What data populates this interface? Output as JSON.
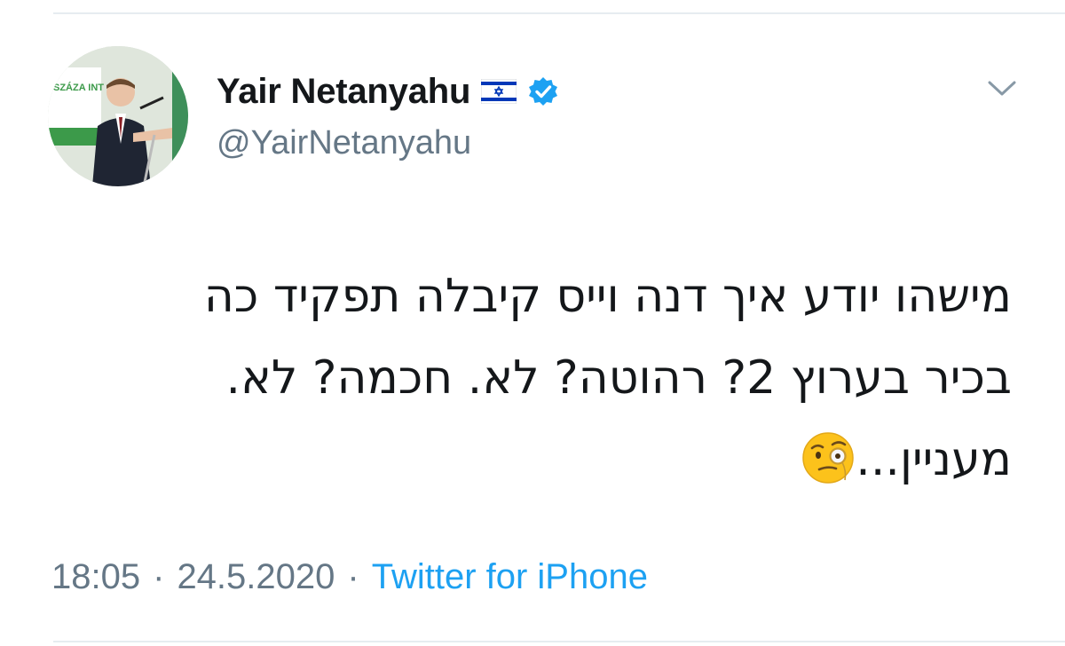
{
  "author": {
    "display_name": "Yair Netanyahu",
    "handle": "@YairNetanyahu",
    "flag_icon": "israel-flag-icon",
    "verified_icon": "verified-badge-icon",
    "avatar_sign_text": "SZÁZA INT"
  },
  "tweet": {
    "lines": [
      "מישהו יודע איך דנה וייס קיבלה תפקיד כה",
      "בכיר בערוץ 2? רהוטה? לא. חכמה? לא.",
      "מעניין..."
    ],
    "emoji": "face-with-monocle-icon"
  },
  "meta": {
    "time": "18:05",
    "separator": "·",
    "date": "24.5.2020",
    "source": "Twitter for iPhone"
  },
  "menu": {
    "icon": "chevron-down-icon"
  },
  "colors": {
    "text": "#14171a",
    "secondary": "#657786",
    "link": "#1da1f2",
    "verified": "#1da1f2",
    "divider": "#e6ecf0"
  }
}
